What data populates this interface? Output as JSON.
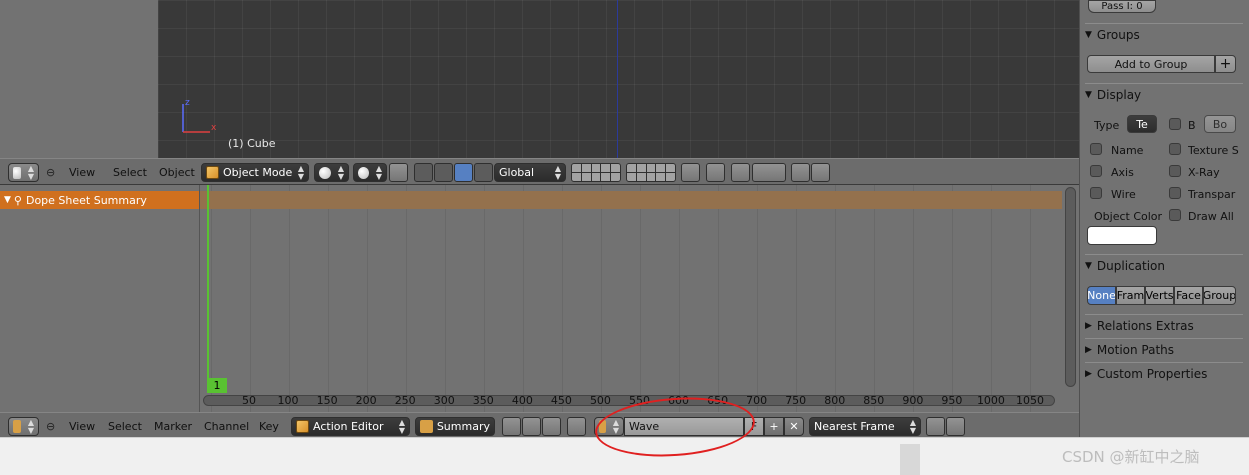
{
  "viewport": {
    "object_label": "(1) Cube",
    "axis_z": "z",
    "axis_x": "x"
  },
  "view3d_header": {
    "menus": [
      "View",
      "Select",
      "Object"
    ],
    "mode": "Object Mode",
    "orientation": "Global"
  },
  "dopesheet": {
    "summary_label": "Dope Sheet Summary",
    "current_frame": "1",
    "ticks": [
      "50",
      "100",
      "150",
      "200",
      "250",
      "300",
      "350",
      "400",
      "450",
      "500",
      "550",
      "600",
      "650",
      "700",
      "750",
      "800",
      "850",
      "900",
      "950",
      "1000",
      "1050"
    ]
  },
  "dope_header": {
    "menus": [
      "View",
      "Select",
      "Marker",
      "Channel",
      "Key"
    ],
    "editor_mode": "Action Editor",
    "summary_btn": "Summary",
    "action_name": "Wave",
    "fake_user": "F",
    "snap_mode": "Nearest Frame"
  },
  "properties": {
    "pass_index": "Pass I: 0",
    "groups": {
      "title": "Groups",
      "add_btn": "Add to Group"
    },
    "display": {
      "title": "Display",
      "type_label": "Type",
      "type_value": "Te",
      "b_label": "B",
      "bo_value": "Bo",
      "name": "Name",
      "texture": "Texture S",
      "axis": "Axis",
      "xray": "X-Ray",
      "wire": "Wire",
      "transparent": "Transpar",
      "object_color": "Object Color",
      "draw_all": "Draw All"
    },
    "duplication": {
      "title": "Duplication",
      "options": [
        "None",
        "Fram",
        "Verts",
        "Face",
        "Group"
      ]
    },
    "relations_extras": "Relations Extras",
    "motion_paths": "Motion Paths",
    "custom_properties": "Custom Properties"
  },
  "watermark": "CSDN @新缸中之脑",
  "colors": {
    "summary": "#d0701e",
    "frame": "#59c232",
    "accent": "#5680c2",
    "annotation": "#e02020"
  }
}
